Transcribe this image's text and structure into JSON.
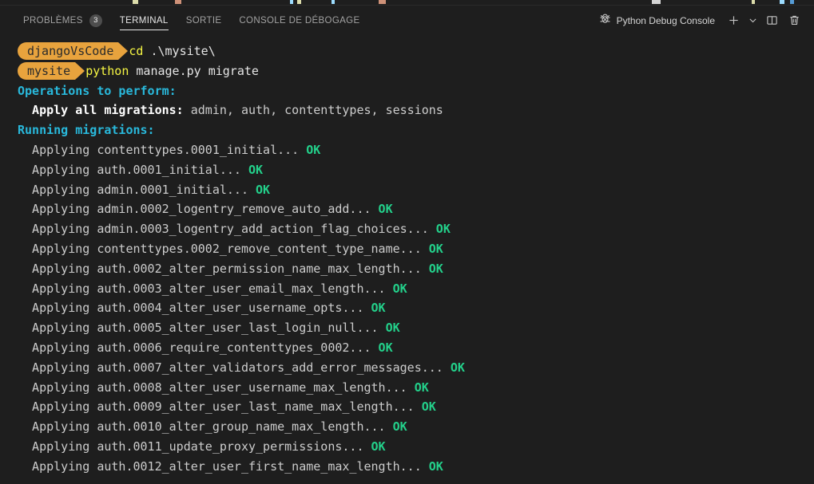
{
  "panel": {
    "tabs": [
      {
        "label": "PROBLÈMES",
        "badge": "3",
        "active": false,
        "name": "tab-problems"
      },
      {
        "label": "TERMINAL",
        "badge": null,
        "active": true,
        "name": "tab-terminal"
      },
      {
        "label": "SORTIE",
        "badge": null,
        "active": false,
        "name": "tab-output"
      },
      {
        "label": "CONSOLE DE DÉBOGAGE",
        "badge": null,
        "active": false,
        "name": "tab-debug-console"
      }
    ],
    "terminal_name": "Python Debug Console",
    "actions": {
      "new_terminal": "+",
      "dropdown": "⌄",
      "split": "Split Terminal",
      "kill": "Kill Terminal"
    }
  },
  "colors": {
    "background": "#1e1e1e",
    "prompt_badge": "#e8a33d",
    "prompt_badge_text": "#2b2b2b",
    "accent_cyan": "#29b8db",
    "accent_green": "#23d18b",
    "accent_yellow": "#f5f543",
    "foreground": "#cccccc",
    "tab_active": "#e7e7e7",
    "tab_inactive": "#a2a2a2",
    "badge_bg": "#4d4d4d"
  },
  "terminal": {
    "prompts": [
      {
        "segment": "djangoVsCode",
        "command_keyword": "cd",
        "command_rest": " .\\mysite\\"
      },
      {
        "segment": "mysite",
        "command_keyword": "python",
        "command_rest": " manage.py migrate"
      }
    ],
    "header_operations": "Operations to perform:",
    "apply_label": "  Apply all migrations:",
    "apply_list": " admin, auth, contenttypes, sessions",
    "header_running": "Running migrations:",
    "migrations": [
      {
        "text": "  Applying contenttypes.0001_initial...",
        "status": "OK"
      },
      {
        "text": "  Applying auth.0001_initial...",
        "status": "OK"
      },
      {
        "text": "  Applying admin.0001_initial...",
        "status": "OK"
      },
      {
        "text": "  Applying admin.0002_logentry_remove_auto_add...",
        "status": "OK"
      },
      {
        "text": "  Applying admin.0003_logentry_add_action_flag_choices...",
        "status": "OK"
      },
      {
        "text": "  Applying contenttypes.0002_remove_content_type_name...",
        "status": "OK"
      },
      {
        "text": "  Applying auth.0002_alter_permission_name_max_length...",
        "status": "OK"
      },
      {
        "text": "  Applying auth.0003_alter_user_email_max_length...",
        "status": "OK"
      },
      {
        "text": "  Applying auth.0004_alter_user_username_opts...",
        "status": "OK"
      },
      {
        "text": "  Applying auth.0005_alter_user_last_login_null...",
        "status": "OK"
      },
      {
        "text": "  Applying auth.0006_require_contenttypes_0002...",
        "status": "OK"
      },
      {
        "text": "  Applying auth.0007_alter_validators_add_error_messages...",
        "status": "OK"
      },
      {
        "text": "  Applying auth.0008_alter_user_username_max_length...",
        "status": "OK"
      },
      {
        "text": "  Applying auth.0009_alter_user_last_name_max_length...",
        "status": "OK"
      },
      {
        "text": "  Applying auth.0010_alter_group_name_max_length...",
        "status": "OK"
      },
      {
        "text": "  Applying auth.0011_update_proxy_permissions...",
        "status": "OK"
      },
      {
        "text": "  Applying auth.0012_alter_user_first_name_max_length...",
        "status": "OK"
      }
    ]
  }
}
